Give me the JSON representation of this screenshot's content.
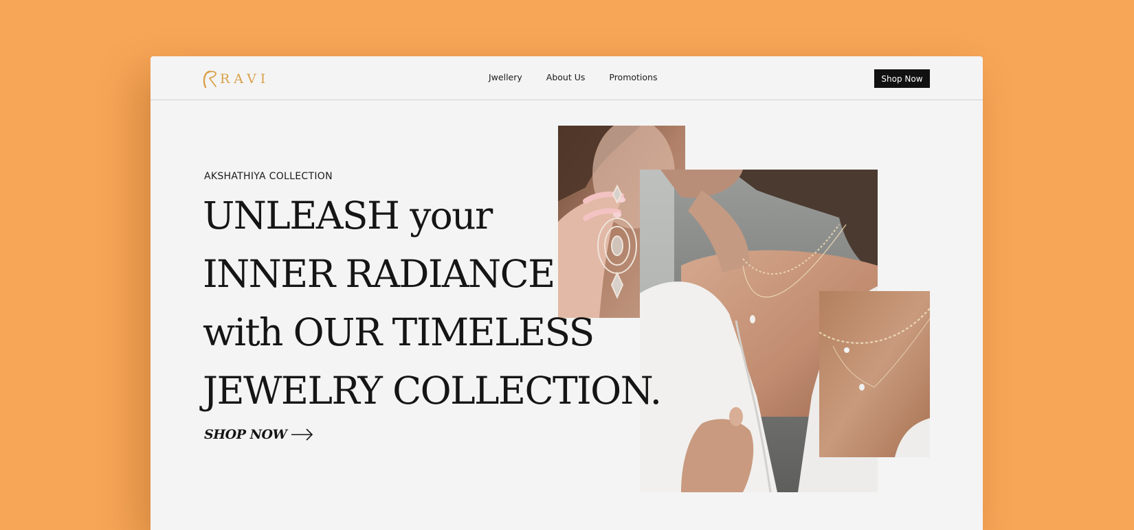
{
  "brand": {
    "name": "RAVI",
    "accent_color": "#D9A04A"
  },
  "nav": {
    "links": [
      {
        "label": "Jwellery"
      },
      {
        "label": "About Us"
      },
      {
        "label": "Promotions"
      }
    ],
    "cta_label": "Shop Now"
  },
  "hero": {
    "eyebrow": "AKSHATHIYA COLLECTION",
    "headline_lines": [
      "UNLEASH your",
      "INNER RADIANCE",
      "with OUR TIMELESS",
      "JEWELRY COLLECTION."
    ],
    "cta_label": "SHOP NOW",
    "cta_icon": "arrow-right-icon"
  },
  "images": [
    {
      "name": "earring-photo"
    },
    {
      "name": "necklace-model-photo"
    },
    {
      "name": "necklace-detail-photo"
    }
  ],
  "colors": {
    "background": "#F7A556",
    "page": "#F4F4F4",
    "text": "#151515",
    "button": "#111111"
  }
}
